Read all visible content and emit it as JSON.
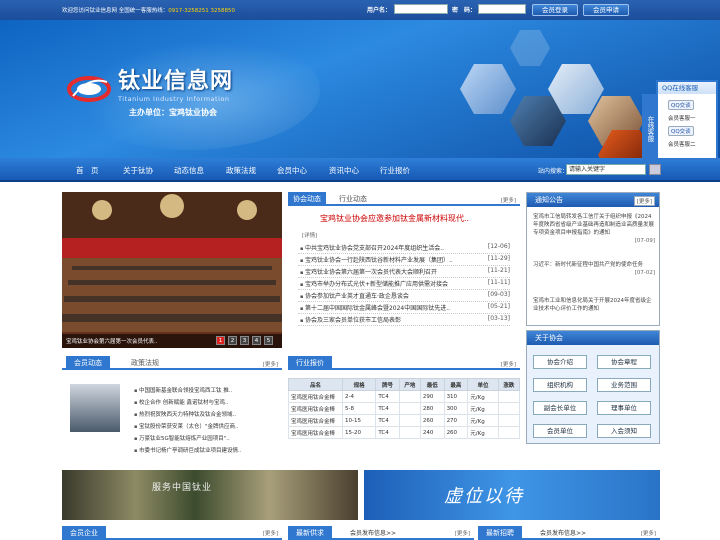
{
  "topbar": {
    "welcome": "欢迎您访问钛业信息网 全国统一客服热线：",
    "hotline": "0917-3258251 3258850",
    "username_label": "用户名：",
    "password_label": "密　码：",
    "login_button": "会员登录",
    "register_button": "会员申请"
  },
  "header": {
    "logo_cn": "钛业信息网",
    "logo_en": "Titanium Industry Information",
    "host": "主办单位：宝鸡钛业协会"
  },
  "nav": {
    "items": [
      "首　页",
      "关于钛协",
      "动态信息",
      "政策法规",
      "会员中心",
      "资讯中心",
      "行业报价"
    ],
    "search_label": "站内搜索：",
    "search_value": "请输入关键字"
  },
  "qq": {
    "title": "QQ在线客服",
    "tab": "在线客服",
    "qq_label": "QQ交谈",
    "agents": [
      "会员客服一",
      "会员客服二"
    ]
  },
  "slideshow": {
    "caption": "宝鸡钛业协会第六届第一次会员代表..",
    "pages": [
      "1",
      "2",
      "3",
      "4",
      "5"
    ],
    "active": 1
  },
  "news": {
    "tabs": [
      "协会动态",
      "行业动态"
    ],
    "more": "[更多]",
    "headline": "宝鸡钛业协会应邀参加钛金属新材料现代..",
    "detail": "[详情]",
    "items": [
      {
        "title": "中共宝鸡钛业协会党支部召开2024年度组织生活会..",
        "date": "[12-06]"
      },
      {
        "title": "宝鸡钛业协会一行赴陕西钛谷新材料产业发展（集团）..",
        "date": "[11-29]"
      },
      {
        "title": "宝鸡钛业协会第六届第一次会员代表大会顺利召开",
        "date": "[11-21]"
      },
      {
        "title": "宝鸡市举办分布式光伏+新型储能推广应用供需对接会",
        "date": "[11-11]"
      },
      {
        "title": "协会参加钛产业英才直通车·政企恳谈会",
        "date": "[09-03]"
      },
      {
        "title": "第十二届中国国际钛金属峰会暨2024中国国际钛先进..",
        "date": "[05-21]"
      },
      {
        "title": "协会及三家会员单位获市工信局表彰",
        "date": "[03-13]"
      }
    ]
  },
  "notice": {
    "title": "通知公告",
    "more": "[更多]",
    "items": [
      {
        "text": "宝鸡市工信局转发各工信厅关于组织申报《2024年度陕西省省级产业基础再造和制造业高质量发展专项资金项目申报指南》的通知",
        "date": "[07-09]"
      },
      {
        "text": "习近平：新时代新征程中国共产党的使命任务",
        "date": "[07-02]"
      },
      {
        "text": "宝鸡市工业和信息化局关于开展2024年度省级企业技术中心评价工作的通知",
        "date": ""
      }
    ]
  },
  "about": {
    "title": "关于协会",
    "buttons": [
      "协会介绍",
      "协会章程",
      "组织机构",
      "业务范围",
      "副会长单位",
      "理事单位",
      "会员单位",
      "入会须知"
    ]
  },
  "member": {
    "tabs": [
      "会员动态",
      "政策法规"
    ],
    "more": "[更多]",
    "items": [
      "中国国新基金联合领投宝鸡西工钛 推..",
      "校企合作 创新赋能 鑫诺钛材与宝鸡..",
      "热烈祝贺陕西天力特种钛及钛合金领域..",
      "宝钛股份荣获安莱（太仓）\"金牌供应商..",
      "万豪钛业5G智能钛熔炼产业园项目\"..",
      "市委书记杨广亭调研巨成钛业项目建设情.."
    ]
  },
  "price": {
    "title": "行业报价",
    "more": "[更多]",
    "headers": [
      "品名",
      "规格",
      "牌号",
      "产地",
      "最低",
      "最高",
      "单位",
      "涨跌"
    ],
    "rows": [
      [
        "宝鸡医用钛合金棒",
        "2-4",
        "TC4",
        "",
        "290",
        "310",
        "元/Kg",
        ""
      ],
      [
        "宝鸡医用钛合金棒",
        "5-8",
        "TC4",
        "",
        "280",
        "300",
        "元/Kg",
        ""
      ],
      [
        "宝鸡医用钛合金棒",
        "10-15",
        "TC4",
        "",
        "260",
        "270",
        "元/Kg",
        ""
      ],
      [
        "宝鸡医用钛合金棒",
        "15-20",
        "TC4",
        "",
        "240",
        "260",
        "元/Kg",
        ""
      ]
    ]
  },
  "bands": {
    "left_text": "服务中国钛业",
    "right_text": "虚位以待"
  },
  "bottom": {
    "enterprise": "会员企业",
    "supply": "最新供求",
    "supply_sub": "会员发布信息>>",
    "recruit": "最新招聘",
    "recruit_sub": "会员发布信息>>",
    "more": "[更多]"
  }
}
